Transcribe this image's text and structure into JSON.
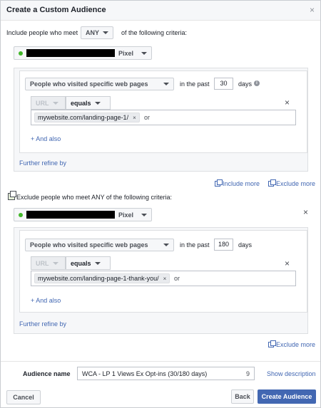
{
  "dialog": {
    "title": "Create a Custom Audience",
    "close_glyph": "×"
  },
  "include": {
    "prefix": "Include people who meet",
    "match_value": "ANY",
    "suffix": "of the following criteria:",
    "pixel_label": "Pixel",
    "rule": {
      "event_select": "People who visited specific web pages",
      "in_the_past": "in the past",
      "days_value": "30",
      "days_label": "days",
      "url_label": "URL",
      "operator": "equals",
      "token": "mywebsite.com/landing-page-1/",
      "or_label": "or",
      "and_also": "+ And also",
      "remove_glyph": "×"
    },
    "further_refine": "Further refine by",
    "include_more": "Include more",
    "exclude_more": "Exclude more"
  },
  "exclude": {
    "criteria_text": "Exclude people who meet ANY of the following criteria:",
    "pixel_label": "Pixel",
    "close_glyph": "×",
    "rule": {
      "event_select": "People who visited specific web pages",
      "in_the_past": "in the past",
      "days_value": "180",
      "days_label": "days",
      "url_label": "URL",
      "operator": "equals",
      "token": "mywebsite.com/landing-page-1-thank-you/",
      "or_label": "or",
      "and_also": "+ And also",
      "remove_glyph": "×"
    },
    "further_refine": "Further refine by",
    "exclude_more": "Exclude more"
  },
  "audience_name": {
    "label": "Audience name",
    "value": "WCA - LP 1 Views Ex Opt-ins (30/180 days)",
    "char_count": "9",
    "show_description": "Show description"
  },
  "footer": {
    "cancel": "Cancel",
    "back": "Back",
    "create": "Create Audience"
  },
  "token_remove_glyph": "×",
  "info_glyph": "i",
  "colors": {
    "accent": "#4267b2",
    "pixel_status": "#42b72a"
  }
}
